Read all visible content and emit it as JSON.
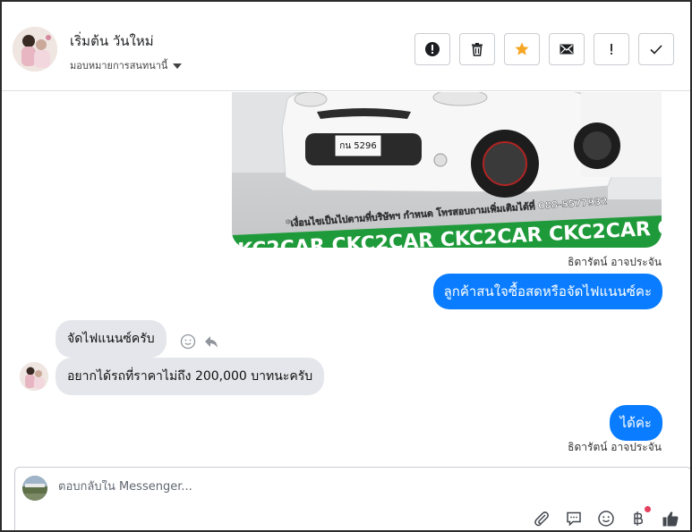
{
  "header": {
    "contact_name": "เริ่มต้น วันใหม่",
    "assign_label": "มอบหมายการสนทนานี้",
    "actions": [
      {
        "icon": "alert-circle-icon"
      },
      {
        "icon": "trash-icon"
      },
      {
        "icon": "star-icon",
        "color": "#f5a623"
      },
      {
        "icon": "mail-icon"
      },
      {
        "icon": "exclamation-icon"
      },
      {
        "icon": "check-icon"
      }
    ]
  },
  "conversation": {
    "image_caption": "*เงื่อนไขเป็นไปตามที่บริษัทฯ กำหนด โทรสอบถามเพิ่มเติมได้ที่ 088-5577932",
    "image_banner": "CKC2CAR CKC2CAR CKC2CAR CKC2CAR CKC2CAR CKC2",
    "image_plate": "กน 5296",
    "messages": [
      {
        "sender": "ธิดารัตน์ อาจประจัน"
      },
      {
        "text": "ลูกค้าสนใจซื้อสดหรือจัดไฟแนนซ์คะ"
      },
      {
        "text": "จัดไฟแนนซ์ครับ"
      },
      {
        "text": "อยากได้รถที่ราคาไม่ถึง 200,000 บาทนะครับ"
      },
      {
        "text": "ได้ค่ะ"
      },
      {
        "sender": "ธิดารัตน์ อาจประจัน"
      }
    ]
  },
  "composer": {
    "placeholder": "ตอบกลับใน Messenger...",
    "tools": [
      "paperclip-icon",
      "chat-bubble-icon",
      "smiley-icon",
      "baht-icon",
      "thumbs-up-icon"
    ]
  },
  "colors": {
    "outgoing_bubble": "#0a7cff",
    "incoming_bubble": "#e4e6eb",
    "star": "#f5a623"
  }
}
